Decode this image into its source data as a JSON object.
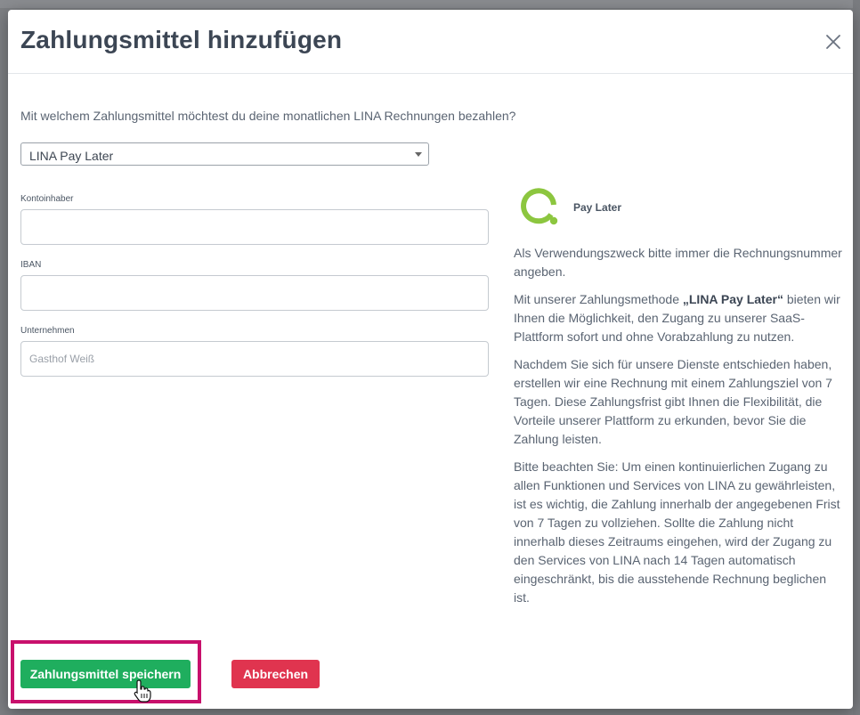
{
  "modal": {
    "title": "Zahlungsmittel hinzufügen",
    "question": "Mit welchem Zahlungsmittel möchtest du deine monatlichen LINA Rechnungen bezahlen?",
    "payment_select": {
      "value": "LINA Pay Later"
    },
    "fields": {
      "account_holder": {
        "label": "Kontoinhaber",
        "value": "",
        "placeholder": ""
      },
      "iban": {
        "label": "IBAN",
        "value": "",
        "placeholder": ""
      },
      "company": {
        "label": "Unternehmen",
        "value": "",
        "placeholder": "Gasthof Weiß"
      }
    },
    "info": {
      "brand_label": "Pay Later",
      "p1": "Als Verwendungszweck bitte immer die Rechnungsnummer angeben.",
      "p2_before": "Mit unserer Zahlungsmethode ",
      "p2_bold": "„LINA Pay Later“",
      "p2_after": " bieten wir Ihnen die Möglichkeit, den Zugang zu unserer SaaS-Plattform sofort und ohne Vorabzahlung zu nutzen.",
      "p3": "Nachdem Sie sich für unsere Dienste entschieden haben, erstellen wir eine Rechnung mit einem Zahlungsziel von 7 Tagen. Diese Zahlungsfrist gibt Ihnen die Flexibilität, die Vorteile unserer Plattform zu erkunden, bevor Sie die Zahlung leisten.",
      "p4": "Bitte beachten Sie: Um einen kontinuierlichen Zugang zu allen Funktionen und Services von LINA zu gewährleisten, ist es wichtig, die Zahlung innerhalb der angegebenen Frist von 7 Tagen zu vollziehen. Sollte die Zahlung nicht innerhalb dieses Zeitraums eingehen, wird der Zugang zu den Services von LINA nach 14 Tagen automatisch eingeschränkt, bis die ausstehende Rechnung beglichen ist."
    },
    "buttons": {
      "save_label": "Zahlungsmittel speichern",
      "cancel_label": "Abbrechen"
    }
  },
  "colors": {
    "save_button": "#1fae5e",
    "cancel_button": "#e0344f",
    "highlight": "#c8106c",
    "logo": "#8cc63f"
  },
  "icons": {
    "close": "close-icon",
    "dropdown": "chevron-down-icon",
    "logo": "lina-pay-later-logo",
    "cursor": "hand-pointer-icon"
  }
}
